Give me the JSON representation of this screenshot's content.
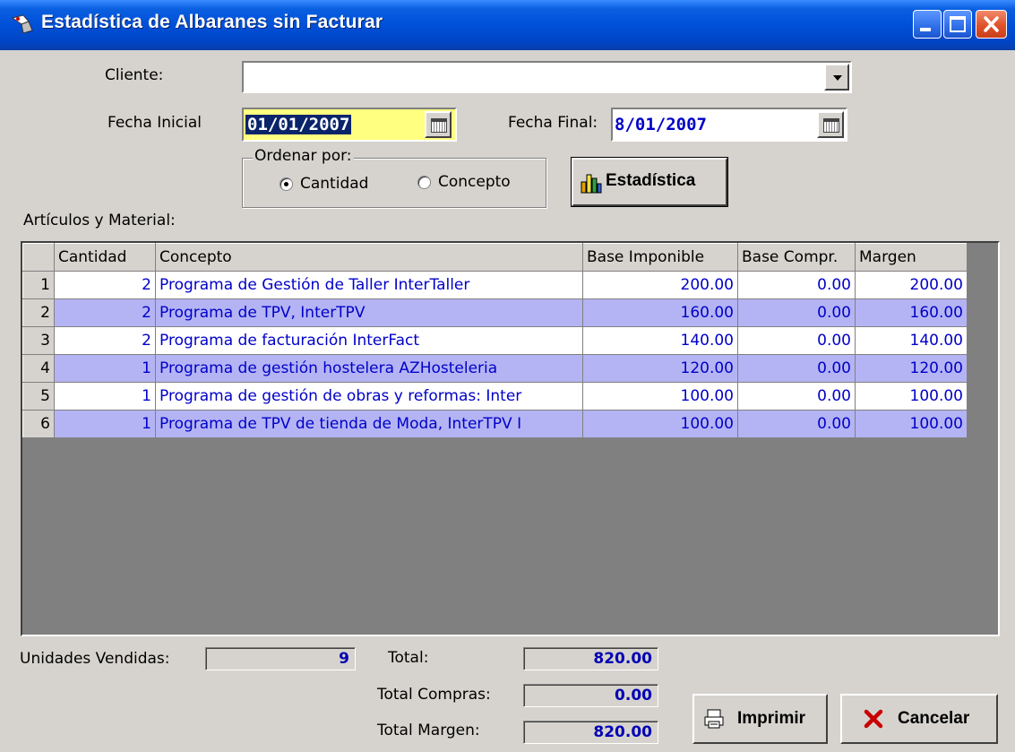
{
  "window": {
    "title": "Estadística de Albaranes sin Facturar"
  },
  "filters": {
    "client_label": "Cliente:",
    "client_value": "",
    "start_label": "Fecha Inicial",
    "start_value": "01/01/2007",
    "end_label": "Fecha Final:",
    "end_value": "8/01/2007",
    "order_label": "Ordenar por:",
    "order_options": [
      "Cantidad",
      "Concepto"
    ],
    "order_selected": "Cantidad",
    "stats_button": "Estadística"
  },
  "grid": {
    "caption": "Artículos y Material:",
    "columns": [
      "Cantidad",
      "Concepto",
      "Base Imponible",
      "Base Compr.",
      "Margen"
    ],
    "rows": [
      {
        "n": "1",
        "cantidad": "2",
        "concepto": "Programa de Gestión de Taller InterTaller",
        "base": "200.00",
        "compra": "0.00",
        "margen": "200.00"
      },
      {
        "n": "2",
        "cantidad": "2",
        "concepto": "Programa de TPV, InterTPV",
        "base": "160.00",
        "compra": "0.00",
        "margen": "160.00"
      },
      {
        "n": "3",
        "cantidad": "2",
        "concepto": "Programa de facturación InterFact",
        "base": "140.00",
        "compra": "0.00",
        "margen": "140.00"
      },
      {
        "n": "4",
        "cantidad": "1",
        "concepto": "Programa de gestión hostelera AZHosteleria",
        "base": "120.00",
        "compra": "0.00",
        "margen": "120.00"
      },
      {
        "n": "5",
        "cantidad": "1",
        "concepto": "Programa de gestión de obras y reformas: Inter",
        "base": "100.00",
        "compra": "0.00",
        "margen": "100.00"
      },
      {
        "n": "6",
        "cantidad": "1",
        "concepto": "Programa de TPV de tienda de Moda, InterTPV I",
        "base": "100.00",
        "compra": "0.00",
        "margen": "100.00"
      }
    ]
  },
  "totals": {
    "units_label": "Unidades Vendidas:",
    "units_value": "9",
    "total_label": "Total:",
    "total_value": "820.00",
    "purchases_label": "Total Compras:",
    "purchases_value": "0.00",
    "margin_label": "Total Margen:",
    "margin_value": "820.00"
  },
  "actions": {
    "print": "Imprimir",
    "cancel": "Cancelar"
  },
  "colors": {
    "title_bar": "#0050d8",
    "row_alt": "#b4b4f4",
    "value_text": "#0000c8",
    "date_highlight": "#ffff80"
  }
}
